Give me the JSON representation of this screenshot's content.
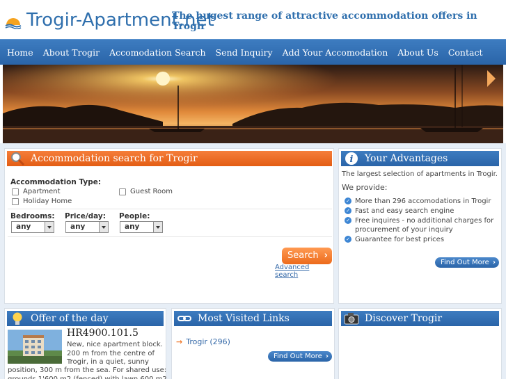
{
  "header": {
    "logo_text": "Trogir-Apartment.net",
    "tagline": "The hugest range of attractive accommodation offers in Trogir"
  },
  "nav": {
    "items": [
      "Home",
      "About Trogir",
      "Accomodation Search",
      "Send Inquiry",
      "Add Your Accomodation",
      "About Us",
      "Contact"
    ]
  },
  "search": {
    "title": "Accommodation search for Trogir",
    "type_label": "Accommodation Type:",
    "types": [
      "Apartment",
      "Guest Room",
      "Holiday Home"
    ],
    "bedrooms_label": "Bedrooms:",
    "price_label": "Price/day:",
    "people_label": "People:",
    "bedrooms_value": "any",
    "price_value": "any",
    "people_value": "any",
    "search_button": "Search",
    "advanced_link": "Advanced search"
  },
  "advantages": {
    "title": "Your Advantages",
    "intro": "The largest selection of apartments in Trogir.",
    "we_provide": "We provide:",
    "items": [
      "More than 296 accomodations in Trogir",
      "Fast and easy search engine",
      "Free inquires - no additional charges for procurement of your inquiry",
      "Guarantee for best prices"
    ],
    "button": "Find Out More"
  },
  "offer": {
    "title": "Offer of the day",
    "price": "HR4900.101.5",
    "description_right": "New, nice apartment block. 200 m from the centre of Trogir, in a quiet, sunny",
    "description_bottom": "position, 300 m from the sea. For shared use: grounds 1'600 m2 (fenced) with lawn 600 m2"
  },
  "links": {
    "title": "Most Visited Links",
    "item": "Trogir (296)",
    "button": "Find Out More"
  },
  "discover": {
    "title": "Discover Trogir"
  },
  "colors": {
    "brand_blue": "#2f6fad",
    "nav_blue": "#3d7cc0",
    "accent_orange": "#ec6a1b"
  }
}
